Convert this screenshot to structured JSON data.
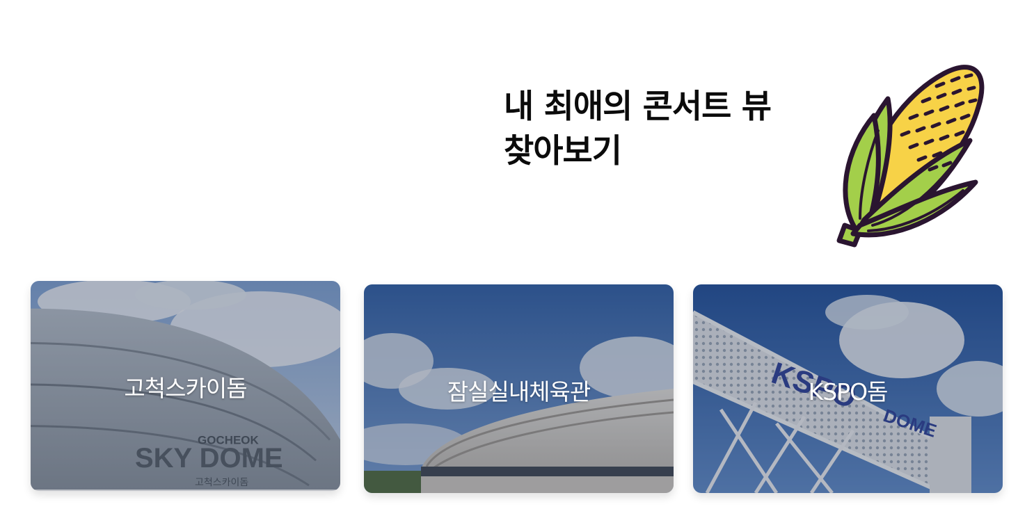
{
  "headline": {
    "line1": "내 최애의 콘서트 뷰",
    "line2": "찾아보기"
  },
  "mascot": {
    "icon": "corn-icon"
  },
  "venues": [
    {
      "name": "고척스카이돔",
      "sign_top": "GOCHEOK",
      "sign_main": "SKY DOME",
      "sign_sub": "고척스카이돔"
    },
    {
      "name": "잠실실내체육관"
    },
    {
      "name": "KSPO돔",
      "sign_main": "KSPO",
      "sign_sub": "DOME"
    }
  ],
  "colors": {
    "corn_yellow": "#f7d247",
    "husk_green": "#a3cf4a",
    "outline": "#2a1530",
    "sky_blue": "#4f79b8"
  }
}
